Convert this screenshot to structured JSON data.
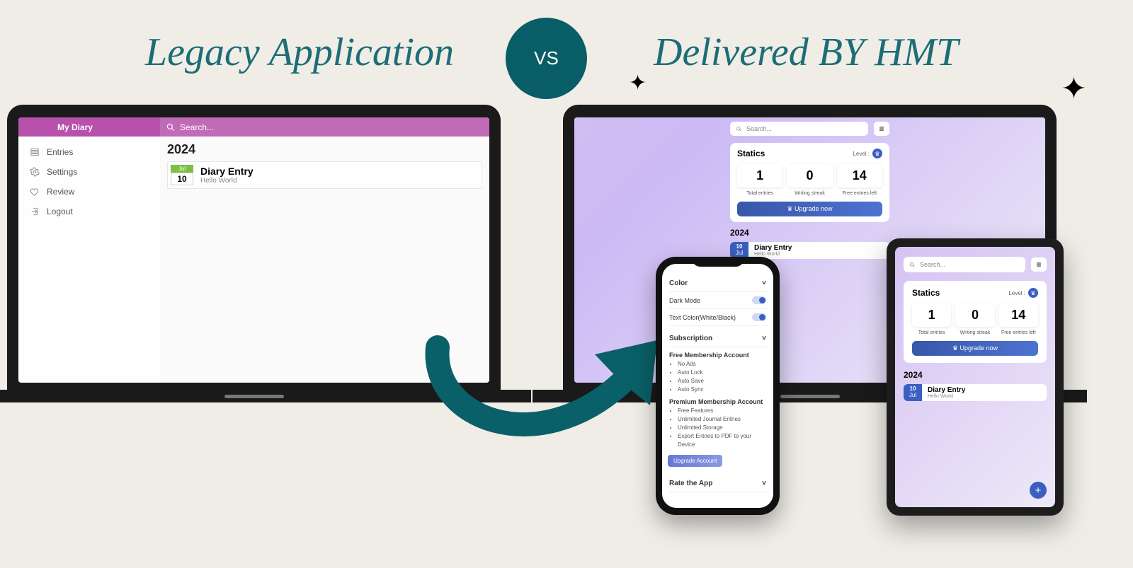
{
  "headings": {
    "left": "Legacy Application",
    "right": "Delivered BY HMT",
    "vs": "VS"
  },
  "legacy": {
    "title": "My Diary",
    "search_placeholder": "Search...",
    "sidebar": [
      {
        "icon": "entries",
        "label": "Entries"
      },
      {
        "icon": "settings",
        "label": "Settings"
      },
      {
        "icon": "review",
        "label": "Review"
      },
      {
        "icon": "logout",
        "label": "Logout"
      }
    ],
    "year": "2024",
    "entry": {
      "month": "Jul",
      "day": "10",
      "title": "Diary Entry",
      "subtitle": "Hello World"
    }
  },
  "hmt": {
    "search_placeholder": "Search...",
    "stats_title": "Statics",
    "level_label": "Level :",
    "stats": [
      {
        "value": "1",
        "label": "Total entries"
      },
      {
        "value": "0",
        "label": "Writing streak"
      },
      {
        "value": "14",
        "label": "Free entries left"
      }
    ],
    "upgrade": "Upgrade now",
    "year": "2024",
    "entry": {
      "day": "10",
      "month": "Jul",
      "title": "Diary Entry",
      "subtitle": "Hello World"
    }
  },
  "phone": {
    "section_color": "Color",
    "dark_mode": "Dark Mode",
    "text_color": "Text Color(White/Black)",
    "section_sub": "Subscription",
    "free_title": "Free Membership Account",
    "free_items": [
      "No Ads",
      "Auto Lock",
      "Auto Save",
      "Auto Sync"
    ],
    "premium_title": "Premium Membership Account",
    "premium_items": [
      "Free Features",
      "Unlimited Journal Entries",
      "Unlimited Storage",
      "Export Entries to PDF to your Device"
    ],
    "upgrade_account": "Upgrade Account",
    "rate": "Rate the App"
  }
}
